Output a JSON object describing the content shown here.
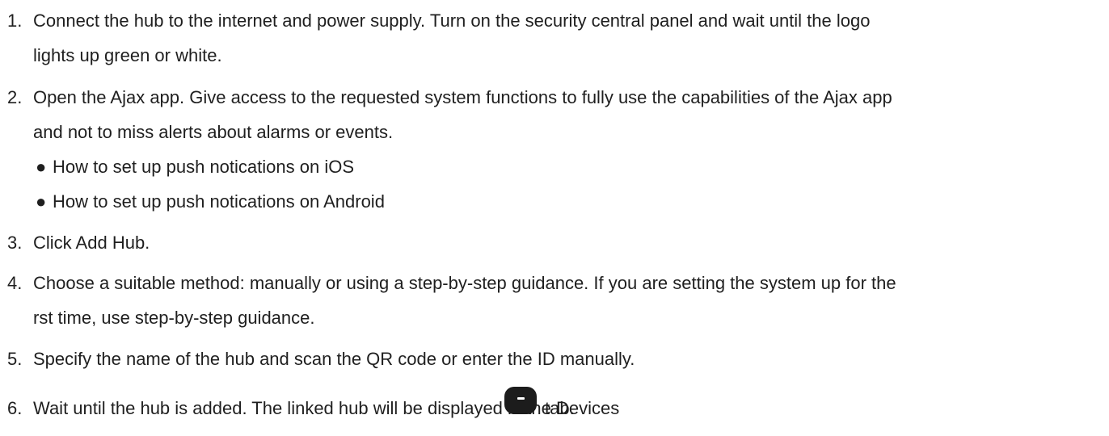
{
  "steps": [
    {
      "number": "1.",
      "lines": [
        "Connect the hub to the internet and power supply. Turn on the security central panel and wait until the logo",
        "lights up green or white."
      ]
    },
    {
      "number": "2.",
      "lines": [
        "Open the Ajax app. Give access to the requested system functions to fully use the capabilities of the Ajax app",
        "and not to miss alerts about alarms or events."
      ],
      "bullets": [
        "How to set up push notications on iOS",
        "How to set up push notications on Android"
      ]
    },
    {
      "number": "3.",
      "lines": [
        "Click Add Hub."
      ]
    },
    {
      "number": "4.",
      "lines": [
        "Choose a suitable method: manually or using a step-by-step guidance. If you are setting the system up for the",
        "rst time, use step-by-step guidance."
      ]
    },
    {
      "number": "5.",
      "lines": [
        "Specify the name of the hub and scan the QR code or enter the ID manually."
      ]
    },
    {
      "number": "6.",
      "lines": [
        "Wait until the hub is added. The linked hub will be displayed in the Devices"
      ],
      "after_icon_text": "tab.",
      "icon": "devices-tab-icon"
    }
  ],
  "bullet_glyph": "●"
}
